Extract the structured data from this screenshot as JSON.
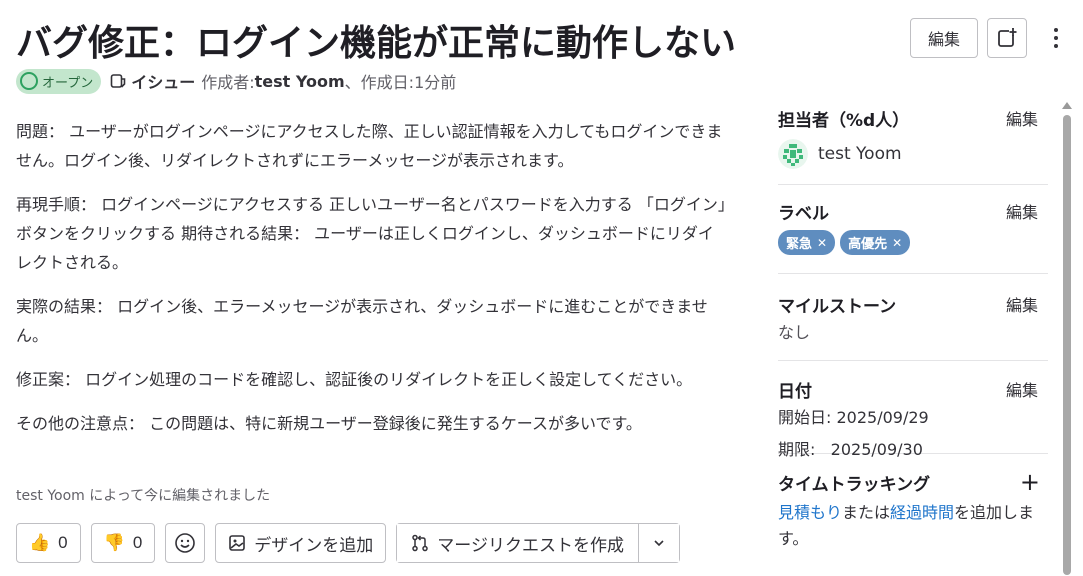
{
  "issue": {
    "title": "バグ修正：ログイン機能が正常に動作しない",
    "status": "オープン",
    "type": "イシュー",
    "author_prefix": "作成者: ",
    "author": "test Yoom",
    "created_sep": "、作成日: ",
    "created": "1分前"
  },
  "header": {
    "edit_label": "編集",
    "todo_icon": "add-todo-icon",
    "more_icon": "more-vertical-icon"
  },
  "description": [
    "問題： ユーザーがログインページにアクセスした際、正しい認証情報を入力してもログインできません。ログイン後、リダイレクトされずにエラーメッセージが表示されます。",
    "再現手順： ログインページにアクセスする 正しいユーザー名とパスワードを入力する 「ログイン」ボタンをクリックする 期待される結果： ユーザーは正しくログインし、ダッシュボードにリダイレクトされる。",
    "実際の結果： ログイン後、エラーメッセージが表示され、ダッシュボードに進むことができません。",
    "修正案： ログイン処理のコードを確認し、認証後のリダイレクトを正しく設定してください。",
    "その他の注意点： この問題は、特に新規ユーザー登録後に発生するケースが多いです。"
  ],
  "edited_note": "test Yoom によって今に編集されました",
  "actions": {
    "thumbs_up_count": "0",
    "thumbs_down_count": "0",
    "add_design": "デザインを追加",
    "create_mr": "マージリクエストを作成"
  },
  "sidebar": {
    "assignee": {
      "title": "担当者（%d人）",
      "edit": "編集",
      "name": "test Yoom"
    },
    "labels": {
      "title": "ラベル",
      "edit": "編集",
      "items": [
        "緊急",
        "高優先"
      ]
    },
    "milestone": {
      "title": "マイルストーン",
      "edit": "編集",
      "value": "なし"
    },
    "dates": {
      "title": "日付",
      "edit": "編集",
      "start": "開始日: 2025/09/29",
      "due": "期限:   2025/09/30"
    },
    "time_tracking": {
      "title": "タイムトラッキング",
      "estimate_link": "見積もり",
      "or": "または",
      "spent_link": "経過時間",
      "suffix": "を追加します。"
    }
  },
  "colors": {
    "status_bg": "#c3e6cd",
    "status_text": "#24663b",
    "label_bg": "#5f8dbf",
    "link": "#1f75cb"
  }
}
